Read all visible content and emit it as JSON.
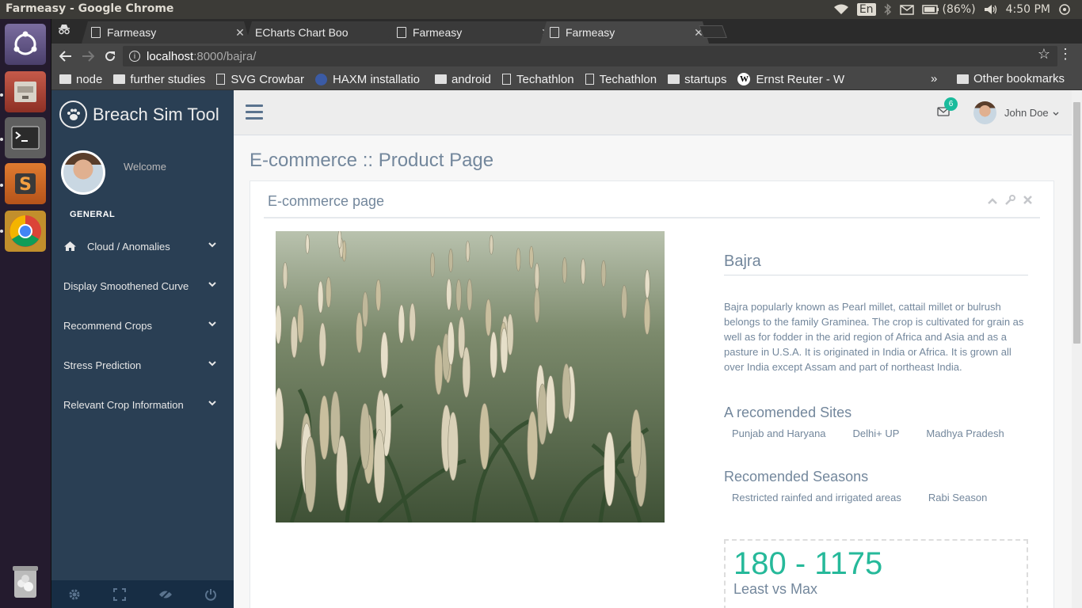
{
  "os": {
    "window_title": "Farmeasy - Google Chrome",
    "language": "En",
    "battery": "(86%)",
    "time": "4:50 PM"
  },
  "browser": {
    "tabs": [
      {
        "title": "Farmeasy"
      },
      {
        "title": "ECharts Chart Boo"
      },
      {
        "title": "Farmeasy"
      },
      {
        "title": "Farmeasy"
      }
    ],
    "url_host": "localhost",
    "url_path": ":8000/bajra/",
    "bookmarks": [
      {
        "label": "node",
        "icon": "folder-icon"
      },
      {
        "label": "further studies",
        "icon": "folder-icon"
      },
      {
        "label": "SVG Crowbar",
        "icon": "page-icon"
      },
      {
        "label": "HAXM installatio",
        "icon": "globe-icon"
      },
      {
        "label": "android",
        "icon": "folder-icon"
      },
      {
        "label": "Techathlon",
        "icon": "page-icon"
      },
      {
        "label": "Techathlon",
        "icon": "page-icon"
      },
      {
        "label": "startups",
        "icon": "folder-icon"
      },
      {
        "label": "Ernst Reuter - W",
        "icon": "wikipedia-icon"
      }
    ],
    "more_bookmarks": "»",
    "other_bookmarks": "Other bookmarks"
  },
  "sidebar": {
    "brand": "Breach Sim Tool",
    "welcome": "Welcome",
    "section": "GENERAL",
    "items": [
      {
        "label": "Cloud / Anomalies"
      },
      {
        "label": "Display Smoothened Curve"
      },
      {
        "label": "Recommend Crops"
      },
      {
        "label": "Stress Prediction"
      },
      {
        "label": "Relevant Crop Information"
      }
    ]
  },
  "topnav": {
    "mail_count": "6",
    "user_name": "John Doe"
  },
  "content": {
    "page_title": "E-commerce :: Product Page",
    "panel_title": "E-commerce page",
    "product": {
      "name": "Bajra",
      "description": "Bajra popularly known as Pearl millet, cattail millet or bulrush belongs to the family Graminea. The crop is cultivated for grain as well as for fodder in the arid region of Africa and Asia and as a pasture in U.S.A. It is originated in India or Africa. It is grown all over India except Assam and part of northeast India.",
      "sites_heading": "A recomended Sites",
      "sites": [
        "Punjab and Haryana",
        "Delhi+ UP",
        "Madhya Pradesh"
      ],
      "seasons_heading": "Recomended Seasons",
      "seasons": [
        "Restricted rainfed and irrigated areas",
        "Rabi Season"
      ],
      "range": "180 - 1175",
      "range_label": "Least vs Max"
    }
  },
  "colors": {
    "sidebar": "#2a3f54",
    "accent": "#26b99a",
    "text": "#73879c"
  }
}
